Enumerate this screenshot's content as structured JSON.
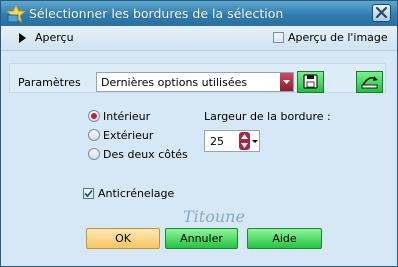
{
  "window": {
    "title": "Sélectionner les bordures de la sélection",
    "close_symbol": "✕"
  },
  "preview": {
    "toggle_label": "Aperçu",
    "image_preview_label": "Aperçu de l'image",
    "image_preview_checked": false
  },
  "presets": {
    "label": "Paramètres",
    "value": "Dernières options utilisées"
  },
  "position": {
    "options": [
      {
        "label": "Intérieur",
        "selected": true
      },
      {
        "label": "Extérieur",
        "selected": false
      },
      {
        "label": "Des deux côtés",
        "selected": false
      }
    ]
  },
  "border_width": {
    "label": "Largeur de la bordure :",
    "value": "25"
  },
  "antialias": {
    "label": "Anticrénelage",
    "checked": true
  },
  "watermark": "Titoune",
  "buttons": {
    "ok": "OK",
    "cancel": "Annuler",
    "help": "Aide"
  },
  "colors": {
    "title_bar": "#2f7db0",
    "ok_button": "#f7c566",
    "green_button": "#23c440",
    "selected_radio": "#c2202c"
  },
  "icons": {
    "title": "paint-star-icon",
    "close": "close-icon",
    "expand": "triangle-right-icon",
    "save_preset": "save-icon",
    "reset": "reset-icon",
    "spinner": "spinner-arrows-icon"
  }
}
